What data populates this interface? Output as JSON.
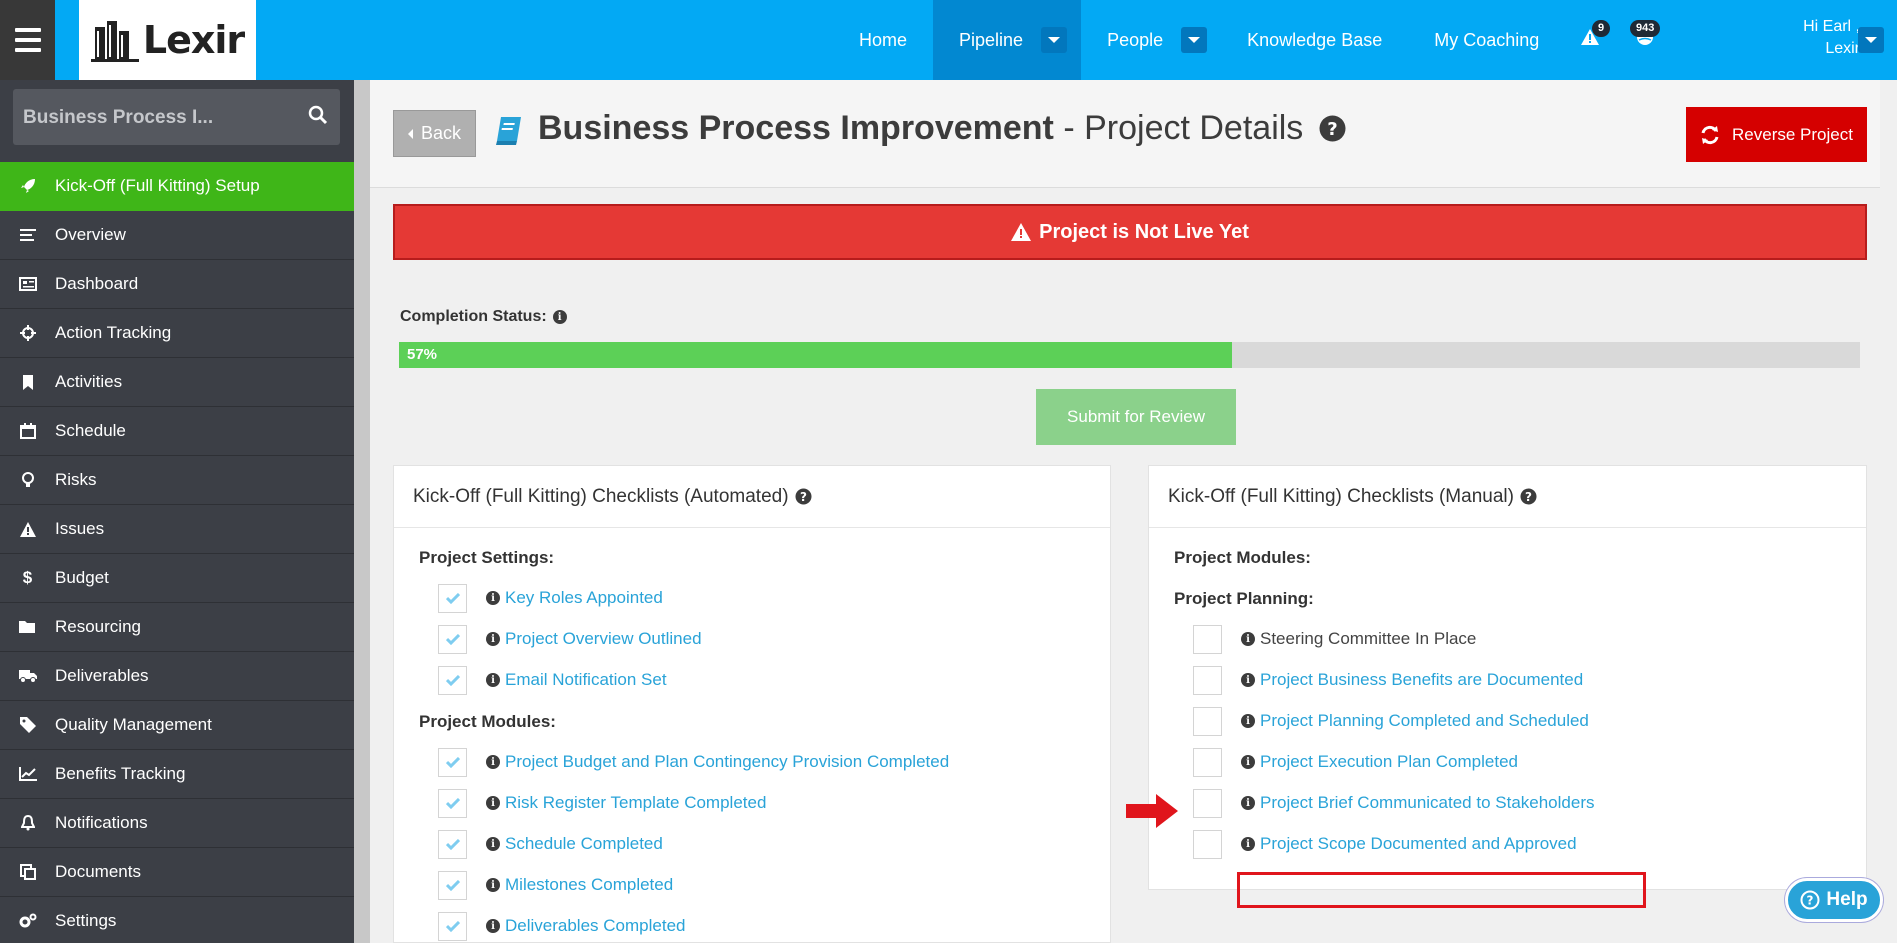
{
  "app": {
    "logo_text": "Lexir"
  },
  "nav": {
    "items": [
      {
        "label": "Home"
      },
      {
        "label": "Pipeline"
      },
      {
        "label": "People"
      },
      {
        "label": "Knowledge Base"
      },
      {
        "label": "My Coaching"
      }
    ],
    "alerts_badge": "9",
    "messages_badge": "943",
    "user_greeting_line1": "Hi Earl ,",
    "user_greeting_line2": "Lexir"
  },
  "sidebar": {
    "search_value": "Business Process I...",
    "items": [
      {
        "label": "Kick-Off (Full Kitting) Setup",
        "icon": "rocket-icon"
      },
      {
        "label": "Overview",
        "icon": "list-icon"
      },
      {
        "label": "Dashboard",
        "icon": "dashboard-icon"
      },
      {
        "label": "Action Tracking",
        "icon": "crosshair-icon"
      },
      {
        "label": "Activities",
        "icon": "bookmark-icon"
      },
      {
        "label": "Schedule",
        "icon": "calendar-icon"
      },
      {
        "label": "Risks",
        "icon": "lightbulb-icon"
      },
      {
        "label": "Issues",
        "icon": "warning-icon"
      },
      {
        "label": "Budget",
        "icon": "dollar-icon"
      },
      {
        "label": "Resourcing",
        "icon": "folder-icon"
      },
      {
        "label": "Deliverables",
        "icon": "truck-icon"
      },
      {
        "label": "Quality Management",
        "icon": "tag-icon"
      },
      {
        "label": "Benefits Tracking",
        "icon": "line-chart-icon"
      },
      {
        "label": "Notifications",
        "icon": "bell-icon"
      },
      {
        "label": "Documents",
        "icon": "documents-icon"
      },
      {
        "label": "Settings",
        "icon": "gears-icon"
      }
    ]
  },
  "header": {
    "back_label": "Back",
    "title_bold": "Business Process Improvement",
    "title_rest": " - Project Details",
    "reverse_label": "Reverse Project"
  },
  "alert": {
    "text": "Project is Not Live Yet"
  },
  "completion": {
    "label": "Completion Status:",
    "percent": 57,
    "percent_text": "57%",
    "submit_label": "Submit for Review"
  },
  "automated": {
    "title": "Kick-Off (Full Kitting) Checklists (Automated)",
    "settings_label": "Project Settings:",
    "settings_items": [
      {
        "label": "Key Roles Appointed",
        "checked": true
      },
      {
        "label": "Project Overview Outlined",
        "checked": true
      },
      {
        "label": "Email Notification Set",
        "checked": true
      }
    ],
    "modules_label": "Project Modules:",
    "modules_items": [
      {
        "label": "Project Budget and Plan Contingency Provision Completed",
        "checked": true
      },
      {
        "label": "Risk Register Template Completed",
        "checked": true
      },
      {
        "label": "Schedule Completed",
        "checked": true
      },
      {
        "label": "Milestones Completed",
        "checked": true
      },
      {
        "label": "Deliverables Completed",
        "checked": true
      }
    ]
  },
  "manual": {
    "title": "Kick-Off (Full Kitting) Checklists (Manual)",
    "modules_label": "Project Modules:",
    "planning_label": "Project Planning:",
    "items": [
      {
        "label": "Steering Committee In Place",
        "checked": false,
        "link": false
      },
      {
        "label": "Project Business Benefits are Documented",
        "checked": false,
        "link": true
      },
      {
        "label": "Project Planning Completed and Scheduled",
        "checked": false,
        "link": true
      },
      {
        "label": "Project Execution Plan Completed",
        "checked": false,
        "link": true
      },
      {
        "label": "Project Brief Communicated to Stakeholders",
        "checked": false,
        "link": true
      },
      {
        "label": "Project Scope Documented and Approved",
        "checked": false,
        "link": true
      }
    ]
  },
  "help": {
    "label": "Help"
  },
  "colors": {
    "nav_bg": "#03a9f4",
    "sidebar_bg": "#3c3f46",
    "sidebar_active": "#3fb618",
    "alert_bg": "#e53935",
    "progress_fill": "#5cd057",
    "link": "#29a3d8",
    "reverse_btn": "#d50000"
  }
}
